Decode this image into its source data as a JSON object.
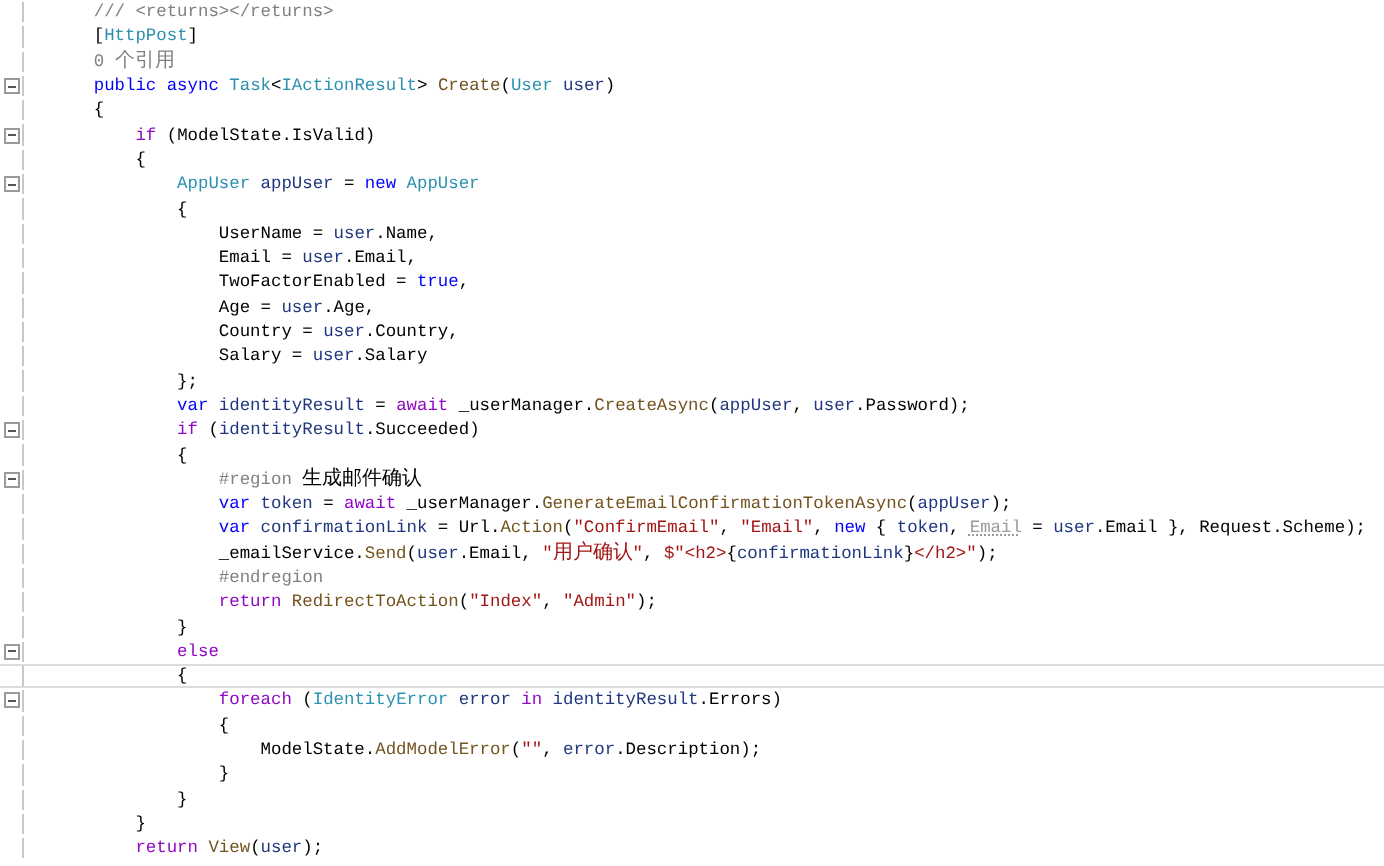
{
  "editor": {
    "lines": [
      {
        "collapsible": false,
        "current": false,
        "tokens": [
          {
            "kind": "comment",
            "text": "    /// <returns></returns>"
          }
        ]
      },
      {
        "collapsible": false,
        "current": false,
        "tokens": [
          {
            "kind": "plain",
            "text": "    ["
          },
          {
            "kind": "type",
            "text": "HttpPost"
          },
          {
            "kind": "plain",
            "text": "]"
          }
        ]
      },
      {
        "collapsible": false,
        "current": false,
        "tokens": [
          {
            "kind": "codelens",
            "text": "    0 个引用"
          }
        ]
      },
      {
        "collapsible": true,
        "current": false,
        "tokens": [
          {
            "kind": "keyword",
            "text": "    public async "
          },
          {
            "kind": "type",
            "text": "Task"
          },
          {
            "kind": "plain",
            "text": "<"
          },
          {
            "kind": "type",
            "text": "IActionResult"
          },
          {
            "kind": "plain",
            "text": "> "
          },
          {
            "kind": "method",
            "text": "Create"
          },
          {
            "kind": "plain",
            "text": "("
          },
          {
            "kind": "type",
            "text": "User "
          },
          {
            "kind": "variable",
            "text": "user"
          },
          {
            "kind": "plain",
            "text": ")"
          }
        ]
      },
      {
        "collapsible": false,
        "current": false,
        "tokens": [
          {
            "kind": "plain",
            "text": "    {"
          }
        ]
      },
      {
        "collapsible": true,
        "current": false,
        "tokens": [
          {
            "kind": "control",
            "text": "        if"
          },
          {
            "kind": "plain",
            "text": " (ModelState.IsValid)"
          }
        ]
      },
      {
        "collapsible": false,
        "current": false,
        "tokens": [
          {
            "kind": "plain",
            "text": "        {"
          }
        ]
      },
      {
        "collapsible": true,
        "current": false,
        "tokens": [
          {
            "kind": "type",
            "text": "            AppUser "
          },
          {
            "kind": "variable",
            "text": "appUser"
          },
          {
            "kind": "plain",
            "text": " = "
          },
          {
            "kind": "keyword",
            "text": "new "
          },
          {
            "kind": "type",
            "text": "AppUser"
          }
        ]
      },
      {
        "collapsible": false,
        "current": false,
        "tokens": [
          {
            "kind": "plain",
            "text": "            {"
          }
        ]
      },
      {
        "collapsible": false,
        "current": false,
        "tokens": [
          {
            "kind": "plain",
            "text": "                UserName = "
          },
          {
            "kind": "variable",
            "text": "user"
          },
          {
            "kind": "plain",
            "text": ".Name,"
          }
        ]
      },
      {
        "collapsible": false,
        "current": false,
        "tokens": [
          {
            "kind": "plain",
            "text": "                Email = "
          },
          {
            "kind": "variable",
            "text": "user"
          },
          {
            "kind": "plain",
            "text": ".Email,"
          }
        ]
      },
      {
        "collapsible": false,
        "current": false,
        "tokens": [
          {
            "kind": "plain",
            "text": "                TwoFactorEnabled = "
          },
          {
            "kind": "keyword",
            "text": "true"
          },
          {
            "kind": "plain",
            "text": ","
          }
        ]
      },
      {
        "collapsible": false,
        "current": false,
        "tokens": [
          {
            "kind": "plain",
            "text": "                Age = "
          },
          {
            "kind": "variable",
            "text": "user"
          },
          {
            "kind": "plain",
            "text": ".Age,"
          }
        ]
      },
      {
        "collapsible": false,
        "current": false,
        "tokens": [
          {
            "kind": "plain",
            "text": "                Country = "
          },
          {
            "kind": "variable",
            "text": "user"
          },
          {
            "kind": "plain",
            "text": ".Country,"
          }
        ]
      },
      {
        "collapsible": false,
        "current": false,
        "tokens": [
          {
            "kind": "plain",
            "text": "                Salary = "
          },
          {
            "kind": "variable",
            "text": "user"
          },
          {
            "kind": "plain",
            "text": ".Salary"
          }
        ]
      },
      {
        "collapsible": false,
        "current": false,
        "tokens": [
          {
            "kind": "plain",
            "text": "            };"
          }
        ]
      },
      {
        "collapsible": false,
        "current": false,
        "tokens": [
          {
            "kind": "keyword",
            "text": "            var "
          },
          {
            "kind": "variable",
            "text": "identityResult"
          },
          {
            "kind": "plain",
            "text": " = "
          },
          {
            "kind": "control",
            "text": "await"
          },
          {
            "kind": "plain",
            "text": " _userManager."
          },
          {
            "kind": "method",
            "text": "CreateAsync"
          },
          {
            "kind": "plain",
            "text": "("
          },
          {
            "kind": "variable",
            "text": "appUser"
          },
          {
            "kind": "plain",
            "text": ", "
          },
          {
            "kind": "variable",
            "text": "user"
          },
          {
            "kind": "plain",
            "text": ".Password);"
          }
        ]
      },
      {
        "collapsible": true,
        "current": false,
        "tokens": [
          {
            "kind": "control",
            "text": "            if"
          },
          {
            "kind": "plain",
            "text": " ("
          },
          {
            "kind": "variable",
            "text": "identityResult"
          },
          {
            "kind": "plain",
            "text": ".Succeeded)"
          }
        ]
      },
      {
        "collapsible": false,
        "current": false,
        "tokens": [
          {
            "kind": "plain",
            "text": "            {"
          }
        ]
      },
      {
        "collapsible": true,
        "current": false,
        "tokens": [
          {
            "kind": "comment",
            "text": "                #region"
          },
          {
            "kind": "plain",
            "text": " 生成邮件确认"
          }
        ]
      },
      {
        "collapsible": false,
        "current": false,
        "tokens": [
          {
            "kind": "keyword",
            "text": "                var "
          },
          {
            "kind": "variable",
            "text": "token"
          },
          {
            "kind": "plain",
            "text": " = "
          },
          {
            "kind": "control",
            "text": "await"
          },
          {
            "kind": "plain",
            "text": " _userManager."
          },
          {
            "kind": "method",
            "text": "GenerateEmailConfirmationTokenAsync"
          },
          {
            "kind": "plain",
            "text": "("
          },
          {
            "kind": "variable",
            "text": "appUser"
          },
          {
            "kind": "plain",
            "text": ");"
          }
        ]
      },
      {
        "collapsible": false,
        "current": false,
        "tokens": [
          {
            "kind": "keyword",
            "text": "                var "
          },
          {
            "kind": "variable",
            "text": "confirmationLink"
          },
          {
            "kind": "plain",
            "text": " = Url."
          },
          {
            "kind": "method",
            "text": "Action"
          },
          {
            "kind": "plain",
            "text": "("
          },
          {
            "kind": "string",
            "text": "\"ConfirmEmail\""
          },
          {
            "kind": "plain",
            "text": ", "
          },
          {
            "kind": "string",
            "text": "\"Email\""
          },
          {
            "kind": "plain",
            "text": ", "
          },
          {
            "kind": "keyword",
            "text": "new"
          },
          {
            "kind": "plain",
            "text": " { "
          },
          {
            "kind": "variable",
            "text": "token"
          },
          {
            "kind": "plain",
            "text": ", "
          },
          {
            "kind": "hint",
            "text": "Email"
          },
          {
            "kind": "plain",
            "text": " = "
          },
          {
            "kind": "variable",
            "text": "user"
          },
          {
            "kind": "plain",
            "text": ".Email }, Request.Scheme);"
          }
        ]
      },
      {
        "collapsible": false,
        "current": false,
        "tokens": [
          {
            "kind": "plain",
            "text": "                _emailService."
          },
          {
            "kind": "method",
            "text": "Send"
          },
          {
            "kind": "plain",
            "text": "("
          },
          {
            "kind": "variable",
            "text": "user"
          },
          {
            "kind": "plain",
            "text": ".Email, "
          },
          {
            "kind": "string",
            "text": "\"用户确认\""
          },
          {
            "kind": "plain",
            "text": ", "
          },
          {
            "kind": "string",
            "text": "$\"<h2>"
          },
          {
            "kind": "plain",
            "text": "{"
          },
          {
            "kind": "variable",
            "text": "confirmationLink"
          },
          {
            "kind": "plain",
            "text": "}"
          },
          {
            "kind": "string",
            "text": "</h2>\""
          },
          {
            "kind": "plain",
            "text": ");"
          }
        ]
      },
      {
        "collapsible": false,
        "current": false,
        "tokens": [
          {
            "kind": "comment",
            "text": "                #endregion"
          }
        ]
      },
      {
        "collapsible": false,
        "current": false,
        "tokens": [
          {
            "kind": "control",
            "text": "                return "
          },
          {
            "kind": "method",
            "text": "RedirectToAction"
          },
          {
            "kind": "plain",
            "text": "("
          },
          {
            "kind": "string",
            "text": "\"Index\""
          },
          {
            "kind": "plain",
            "text": ", "
          },
          {
            "kind": "string",
            "text": "\"Admin\""
          },
          {
            "kind": "plain",
            "text": ");"
          }
        ]
      },
      {
        "collapsible": false,
        "current": false,
        "tokens": [
          {
            "kind": "plain",
            "text": "            }"
          }
        ]
      },
      {
        "collapsible": true,
        "current": false,
        "tokens": [
          {
            "kind": "control",
            "text": "            else"
          }
        ]
      },
      {
        "collapsible": false,
        "current": true,
        "tokens": [
          {
            "kind": "plain",
            "text": "            {"
          }
        ]
      },
      {
        "collapsible": true,
        "current": false,
        "tokens": [
          {
            "kind": "control",
            "text": "                foreach"
          },
          {
            "kind": "plain",
            "text": " ("
          },
          {
            "kind": "type",
            "text": "IdentityError "
          },
          {
            "kind": "variable",
            "text": "error "
          },
          {
            "kind": "control",
            "text": "in "
          },
          {
            "kind": "variable",
            "text": "identityResult"
          },
          {
            "kind": "plain",
            "text": ".Errors)"
          }
        ]
      },
      {
        "collapsible": false,
        "current": false,
        "tokens": [
          {
            "kind": "plain",
            "text": "                {"
          }
        ]
      },
      {
        "collapsible": false,
        "current": false,
        "tokens": [
          {
            "kind": "plain",
            "text": "                    ModelState."
          },
          {
            "kind": "method",
            "text": "AddModelError"
          },
          {
            "kind": "plain",
            "text": "("
          },
          {
            "kind": "string",
            "text": "\"\""
          },
          {
            "kind": "plain",
            "text": ", "
          },
          {
            "kind": "variable",
            "text": "error"
          },
          {
            "kind": "plain",
            "text": ".Description);"
          }
        ]
      },
      {
        "collapsible": false,
        "current": false,
        "tokens": [
          {
            "kind": "plain",
            "text": "                }"
          }
        ]
      },
      {
        "collapsible": false,
        "current": false,
        "tokens": [
          {
            "kind": "plain",
            "text": "            }"
          }
        ]
      },
      {
        "collapsible": false,
        "current": false,
        "tokens": [
          {
            "kind": "plain",
            "text": "        }"
          }
        ]
      },
      {
        "collapsible": false,
        "current": false,
        "tokens": [
          {
            "kind": "control",
            "text": "        return "
          },
          {
            "kind": "method",
            "text": "View"
          },
          {
            "kind": "plain",
            "text": "("
          },
          {
            "kind": "variable",
            "text": "user"
          },
          {
            "kind": "plain",
            "text": ");"
          }
        ]
      }
    ]
  }
}
